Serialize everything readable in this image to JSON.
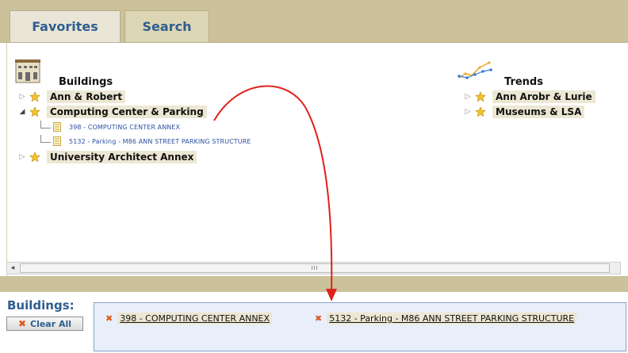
{
  "tabs": [
    {
      "label": "Favorites",
      "active": true
    },
    {
      "label": "Search",
      "active": false
    }
  ],
  "buildings": {
    "title": "Buildings",
    "folders": [
      {
        "label": "Ann & Robert",
        "expanded": false
      },
      {
        "label": "Computing Center & Parking",
        "expanded": true,
        "children": [
          "398 - COMPUTING CENTER ANNEX",
          "5132 - Parking - M86 ANN STREET PARKING STRUCTURE"
        ]
      },
      {
        "label": "University Architect Annex",
        "expanded": false
      }
    ]
  },
  "trends": {
    "title": "Trends",
    "folders": [
      {
        "label": "Ann Arobr & Lurie"
      },
      {
        "label": "Museums & LSA"
      }
    ]
  },
  "scrollbar": {
    "left_arrow": "◂",
    "grip": "III"
  },
  "selection": {
    "title": "Buildings:",
    "clear_all": "Clear All",
    "chips": [
      "398 - COMPUTING CENTER ANNEX",
      "5132 - Parking - M86 ANN STREET PARKING STRUCTURE"
    ]
  },
  "colors": {
    "tab_bar": "#cbc29b",
    "accent_text": "#2f5d8f",
    "arrow": "#e0201a",
    "drop_zone": "#e9eefb"
  },
  "icons": [
    "building-icon",
    "trend-chart-icon",
    "star-icon",
    "document-icon",
    "close-x-icon",
    "expand-triangle-icon",
    "collapse-triangle-icon"
  ]
}
